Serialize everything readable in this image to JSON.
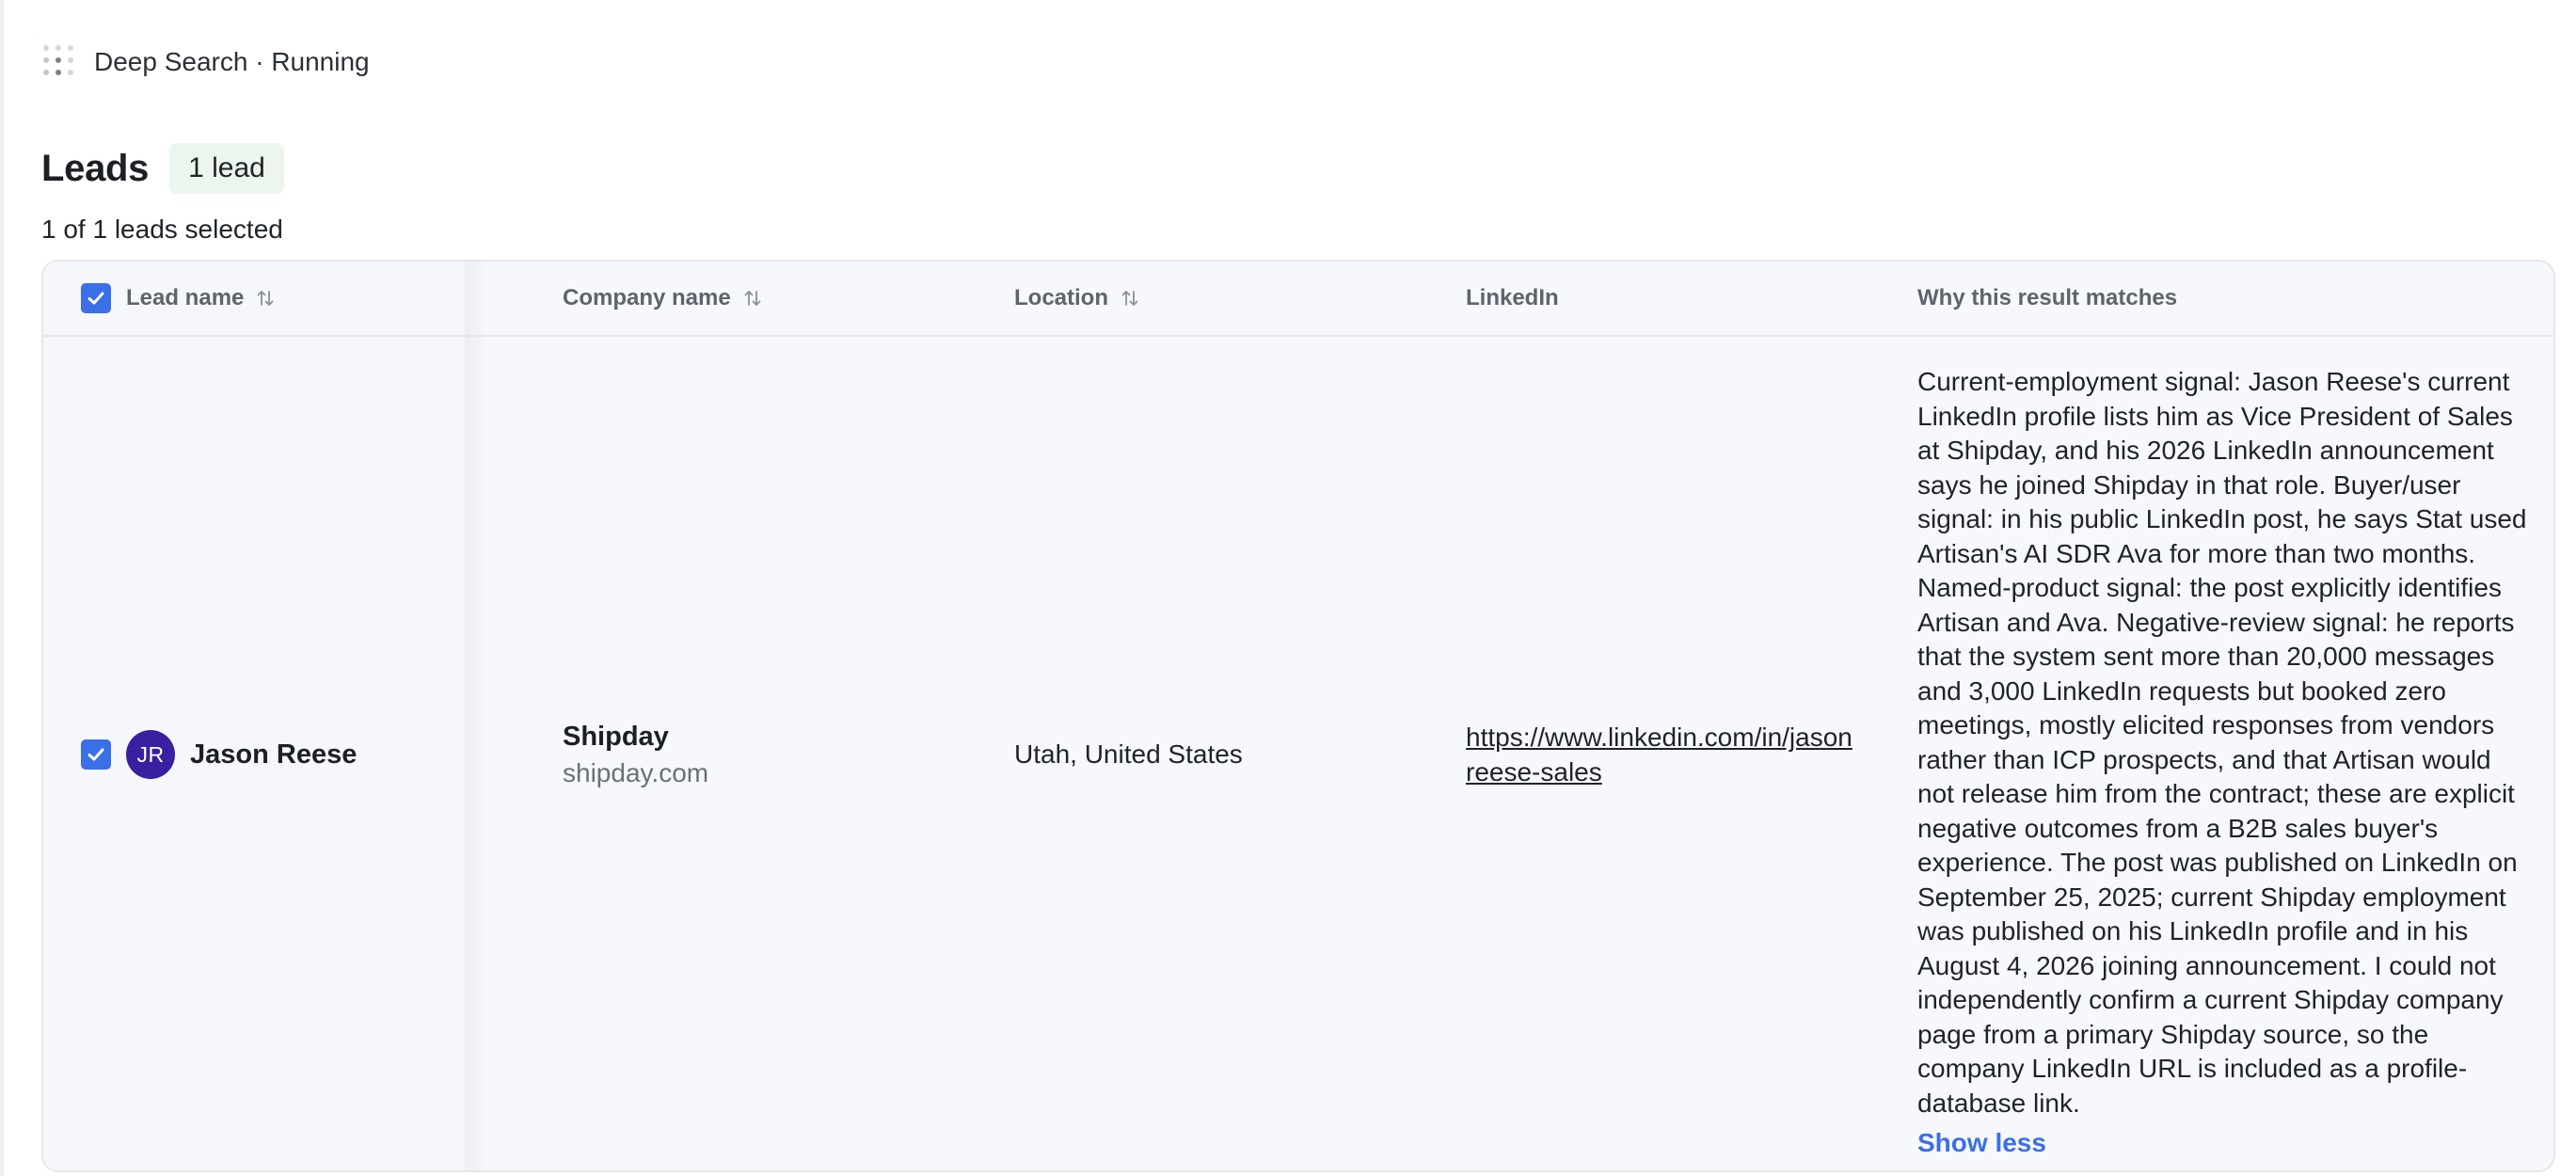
{
  "topbar": {
    "title": "Deep Search · Running",
    "icon": "dots-grid-icon"
  },
  "leads": {
    "title": "Leads",
    "count_badge": "1 lead",
    "selected_summary": "1 of 1 leads selected"
  },
  "table": {
    "columns": [
      {
        "label": "Lead name",
        "sortable": true
      },
      {
        "label": "Company name",
        "sortable": true
      },
      {
        "label": "Location",
        "sortable": true
      },
      {
        "label": "LinkedIn",
        "sortable": false
      },
      {
        "label": "Why this result matches",
        "sortable": false
      }
    ],
    "rows": [
      {
        "selected": true,
        "avatar_initials": "JR",
        "avatar_color": "#3a1fa1",
        "lead_name": "Jason Reese",
        "company_name": "Shipday",
        "company_domain": "shipday.com",
        "location": "Utah, United States",
        "linkedin": "https://www.linkedin.com/in/jasonreese-sales",
        "why": "Current-employment signal: Jason Reese's current LinkedIn profile lists him as Vice President of Sales at Shipday, and his 2026 LinkedIn announcement says he joined Shipday in that role. Buyer/user signal: in his public LinkedIn post, he says Stat used Artisan's AI SDR Ava for more than two months. Named-product signal: the post explicitly identifies Artisan and Ava. Negative-review signal: he reports that the system sent more than 20,000 messages and 3,000 LinkedIn requests but booked zero meetings, mostly elicited responses from vendors rather than ICP prospects, and that Artisan would not release him from the contract; these are explicit negative outcomes from a B2B sales buyer's experience. The post was published on LinkedIn on September 25, 2025; current Shipday employment was published on his LinkedIn profile and in his August 4, 2026 joining announcement. I could not independently confirm a current Shipday company page from a primary Shipday source, so the company LinkedIn URL is included as a profile-database link.",
        "toggle_label": "Show less"
      }
    ]
  },
  "colors": {
    "accent": "#3b6fe8",
    "badge_bg": "#ecf6ec",
    "avatar": "#3a1fa1"
  }
}
